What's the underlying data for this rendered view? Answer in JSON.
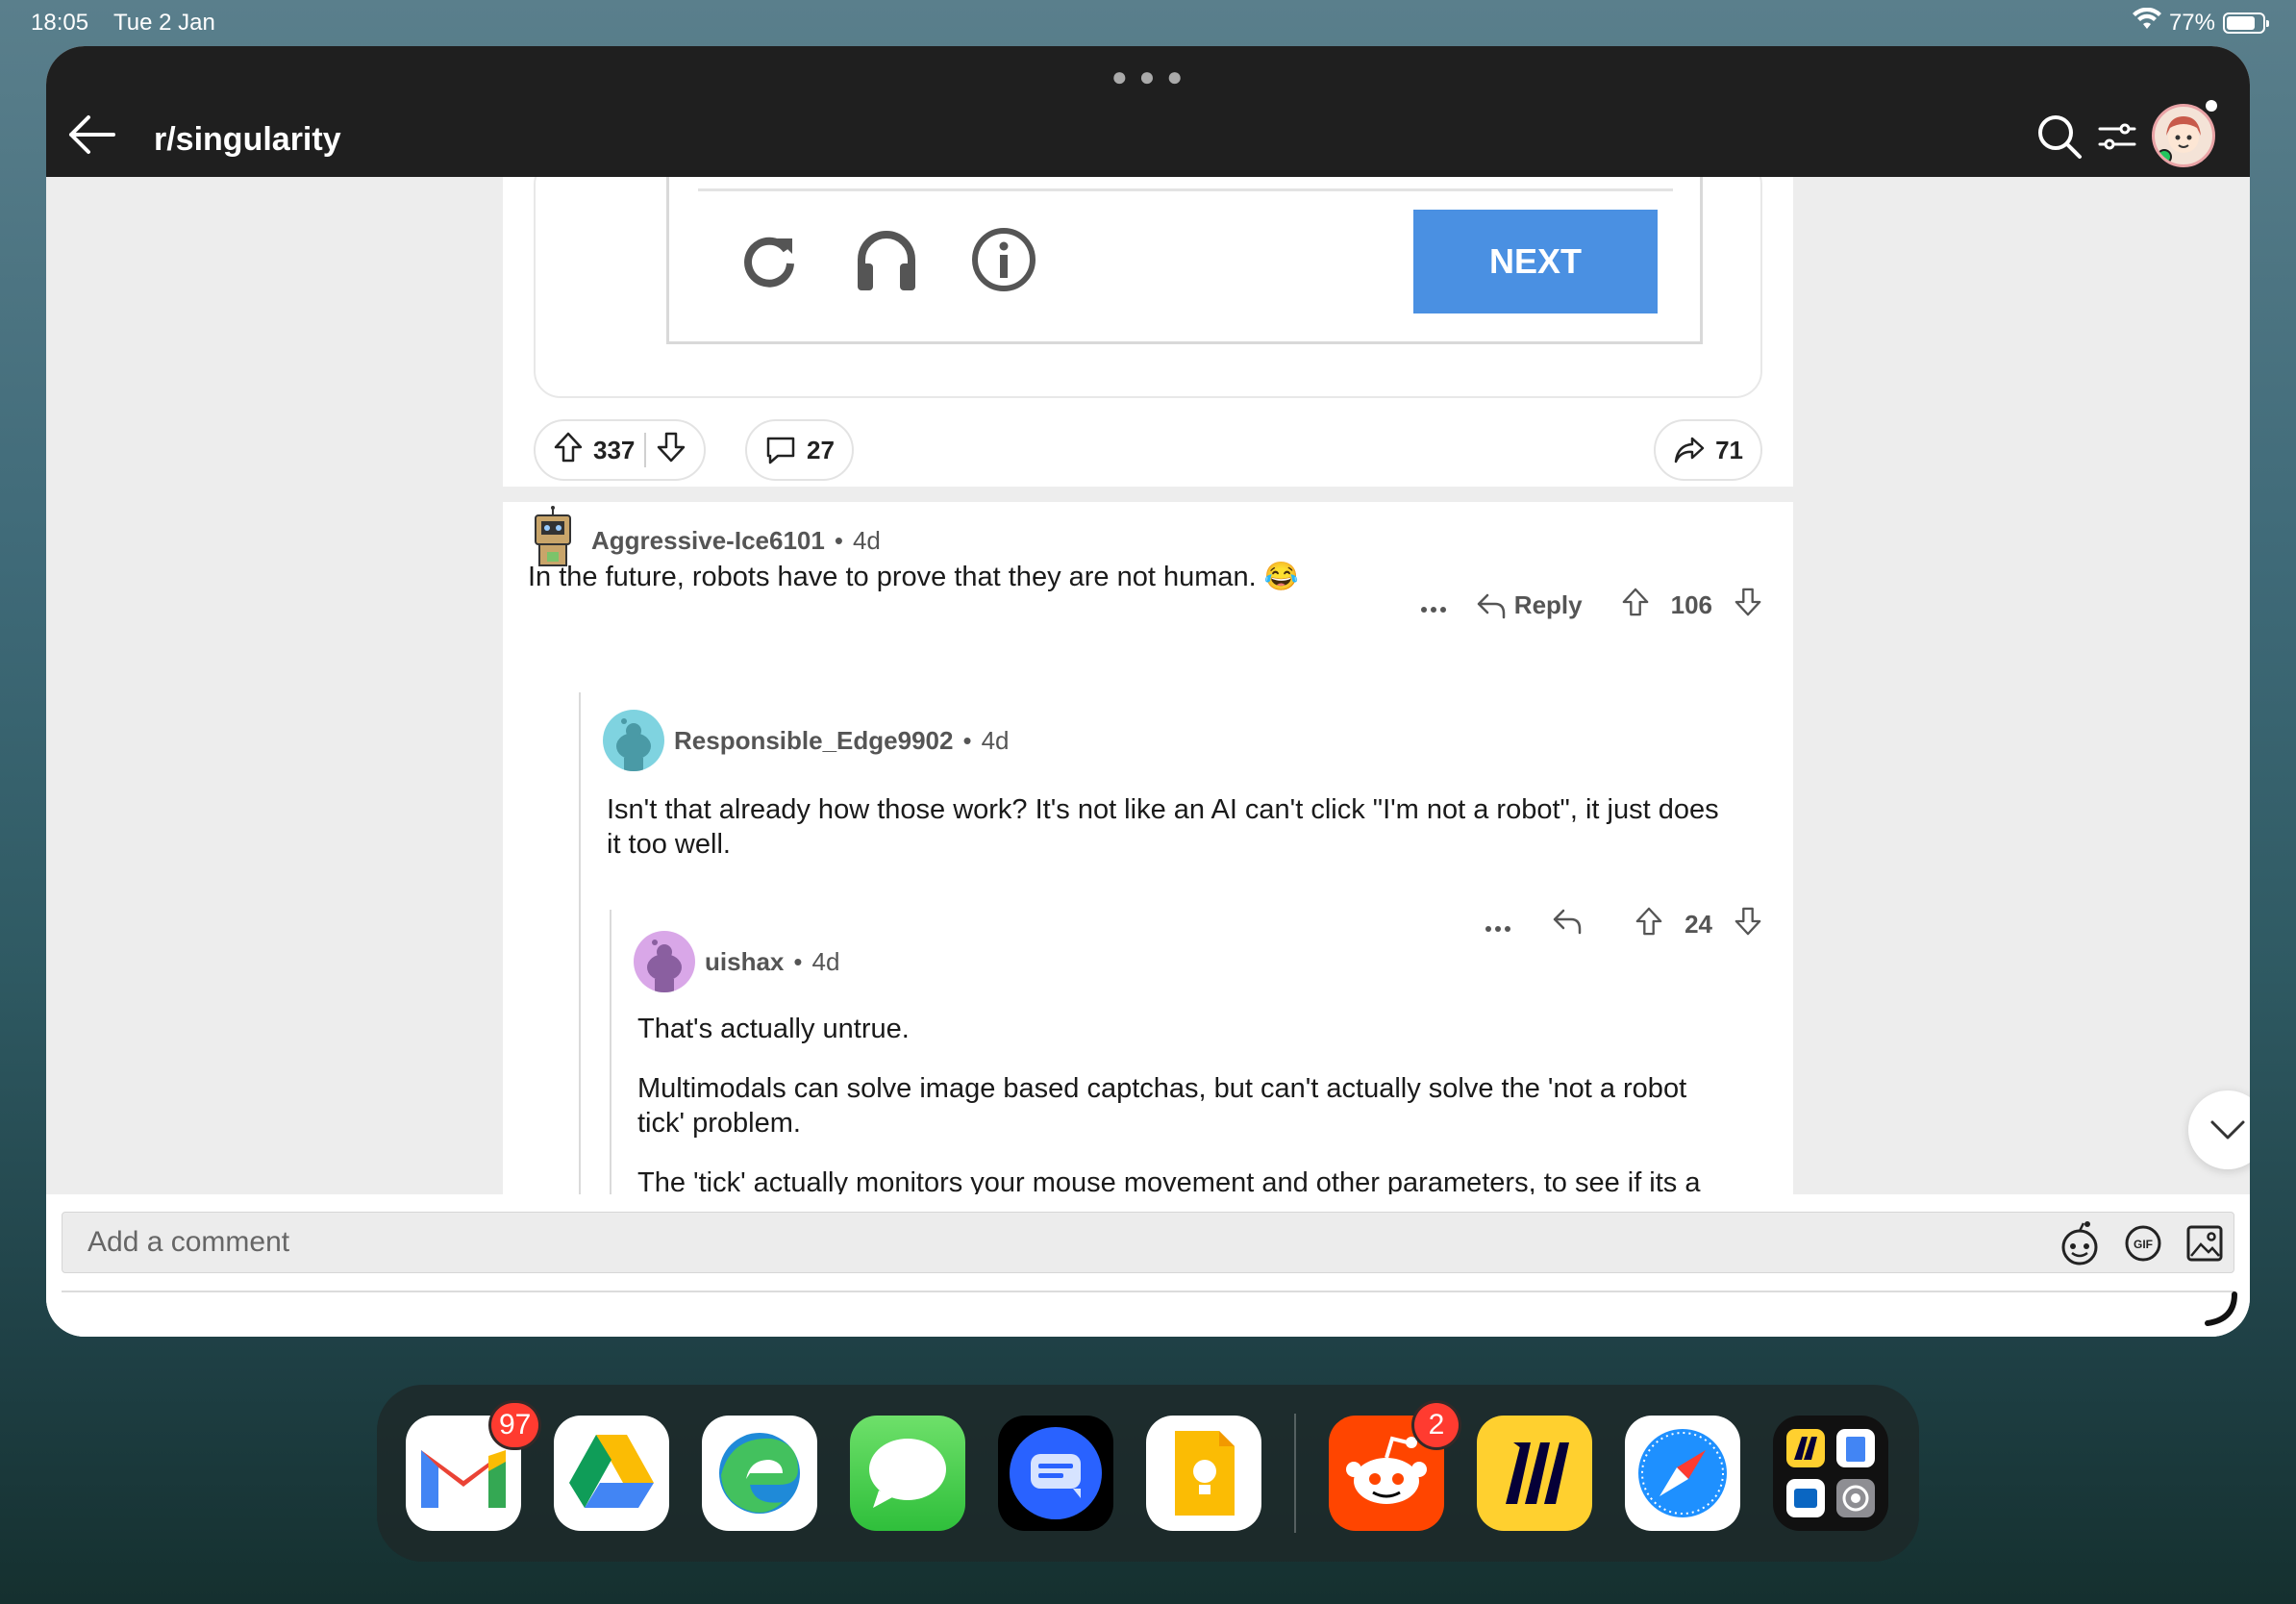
{
  "status_bar": {
    "time": "18:05",
    "date": "Tue 2 Jan",
    "battery": "77%"
  },
  "header": {
    "title": "r/singularity"
  },
  "post": {
    "captcha_button": "NEXT",
    "upvotes": "337",
    "comments": "27",
    "shares": "71"
  },
  "comments": [
    {
      "user": "Aggressive-Ice6101",
      "sep": "•",
      "age": "4d",
      "text": "In the future, robots have to prove that they are not human. 😂",
      "reply_label": "Reply",
      "votes": "106"
    },
    {
      "user": "Responsible_Edge9902",
      "sep": "•",
      "age": "4d",
      "text_line1": "Isn't that already how those work? It's not like an AI can't click \"I'm not a robot\", it just does",
      "text_line2": "it too well.",
      "votes": "24"
    },
    {
      "user": "uishax",
      "sep": "•",
      "age": "4d",
      "para1": "That's actually untrue.",
      "para2_line1": "Multimodals can solve image based captchas, but can't actually solve the 'not a robot",
      "para2_line2": "tick' problem.",
      "para3": "The 'tick' actually monitors your mouse movement and other parameters, to see if its a"
    }
  ],
  "comment_bar": {
    "placeholder": "Add a comment"
  },
  "dock": {
    "badges": {
      "gmail": "97",
      "reddit": "2"
    },
    "apps": [
      "gmail",
      "google-drive",
      "edge",
      "messages",
      "google-messages",
      "google-keep",
      "reddit",
      "miro",
      "safari",
      "folder"
    ]
  }
}
